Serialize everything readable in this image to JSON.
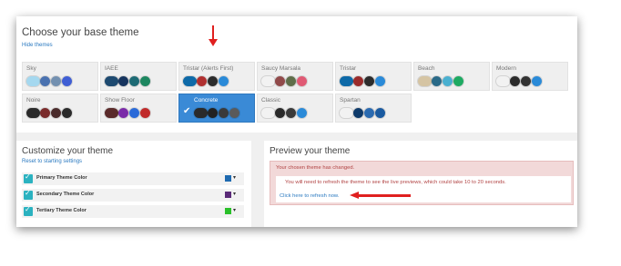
{
  "header": {
    "title": "Choose your base theme",
    "hide_link": "Hide themes"
  },
  "themes": [
    {
      "name": "Sky",
      "colors": [
        "#a5d8ef",
        "#4a72b0",
        "#7390b0",
        "#3f5ed4"
      ]
    },
    {
      "name": "IAEE",
      "colors": [
        "#1e4a70",
        "#16345e",
        "#1d6a74",
        "#1d8760"
      ]
    },
    {
      "name": "Tristar (Alerts First)",
      "colors": [
        "#0e6aa8",
        "#b03030",
        "#2c2c2c",
        "#2a8ad8"
      ]
    },
    {
      "name": "Saucy Marsala",
      "colors": [
        "#f2f2f2",
        "#914a4a",
        "#5f6e4a",
        "#e05a74"
      ]
    },
    {
      "name": "Tristar",
      "colors": [
        "#0e6aa8",
        "#9a2b2b",
        "#2c2c2c",
        "#2a8ad8"
      ]
    },
    {
      "name": "Beach",
      "colors": [
        "#d5c4a3",
        "#2a6a88",
        "#4ab0d0",
        "#1eaa62"
      ]
    },
    {
      "name": "Modern",
      "colors": [
        "#f2f2f2",
        "#2c2c2c",
        "#333333",
        "#2a8ad8"
      ]
    },
    {
      "name": "Noire",
      "colors": [
        "#2a2a2a",
        "#7a2b2b",
        "#4a2b2b",
        "#2a2a2a"
      ]
    },
    {
      "name": "Show Floor",
      "colors": [
        "#5a2a2a",
        "#7a2aa8",
        "#2a6ad8",
        "#c02a2a"
      ]
    },
    {
      "name": "Concrete",
      "colors": [
        "#2a2a2a",
        "#222222",
        "#3a3a3a",
        "#5a5a5a"
      ],
      "selected": true
    },
    {
      "name": "Classic",
      "colors": [
        "#f2f2f2",
        "#2a2a2a",
        "#3a3a3a",
        "#2a8ad8"
      ]
    },
    {
      "name": "Spartan",
      "colors": [
        "#f2f2f2",
        "#0e3a6a",
        "#2a6ab0",
        "#1a5aa0"
      ]
    }
  ],
  "customize": {
    "title": "Customize your theme",
    "reset_link": "Reset to starting settings",
    "rows": [
      {
        "label": "Primary Theme Color",
        "color": "#1e6ab0"
      },
      {
        "label": "Secondary Theme Color",
        "color": "#5a2a78"
      },
      {
        "label": "Tertiary Theme Color",
        "color": "#2ac02a"
      }
    ]
  },
  "preview": {
    "title": "Preview your theme",
    "alert_message": "Your chosen theme has changed.",
    "refresh_note": "You will need to refresh the theme to see the live previews, which could take 10 to 20 seconds.",
    "refresh_link": "Click here to refresh now."
  },
  "colors": {
    "accent": "#3a8ad6",
    "link": "#2a79c0",
    "annotation": "#e0201f",
    "checkbox": "#2bb2c0"
  }
}
